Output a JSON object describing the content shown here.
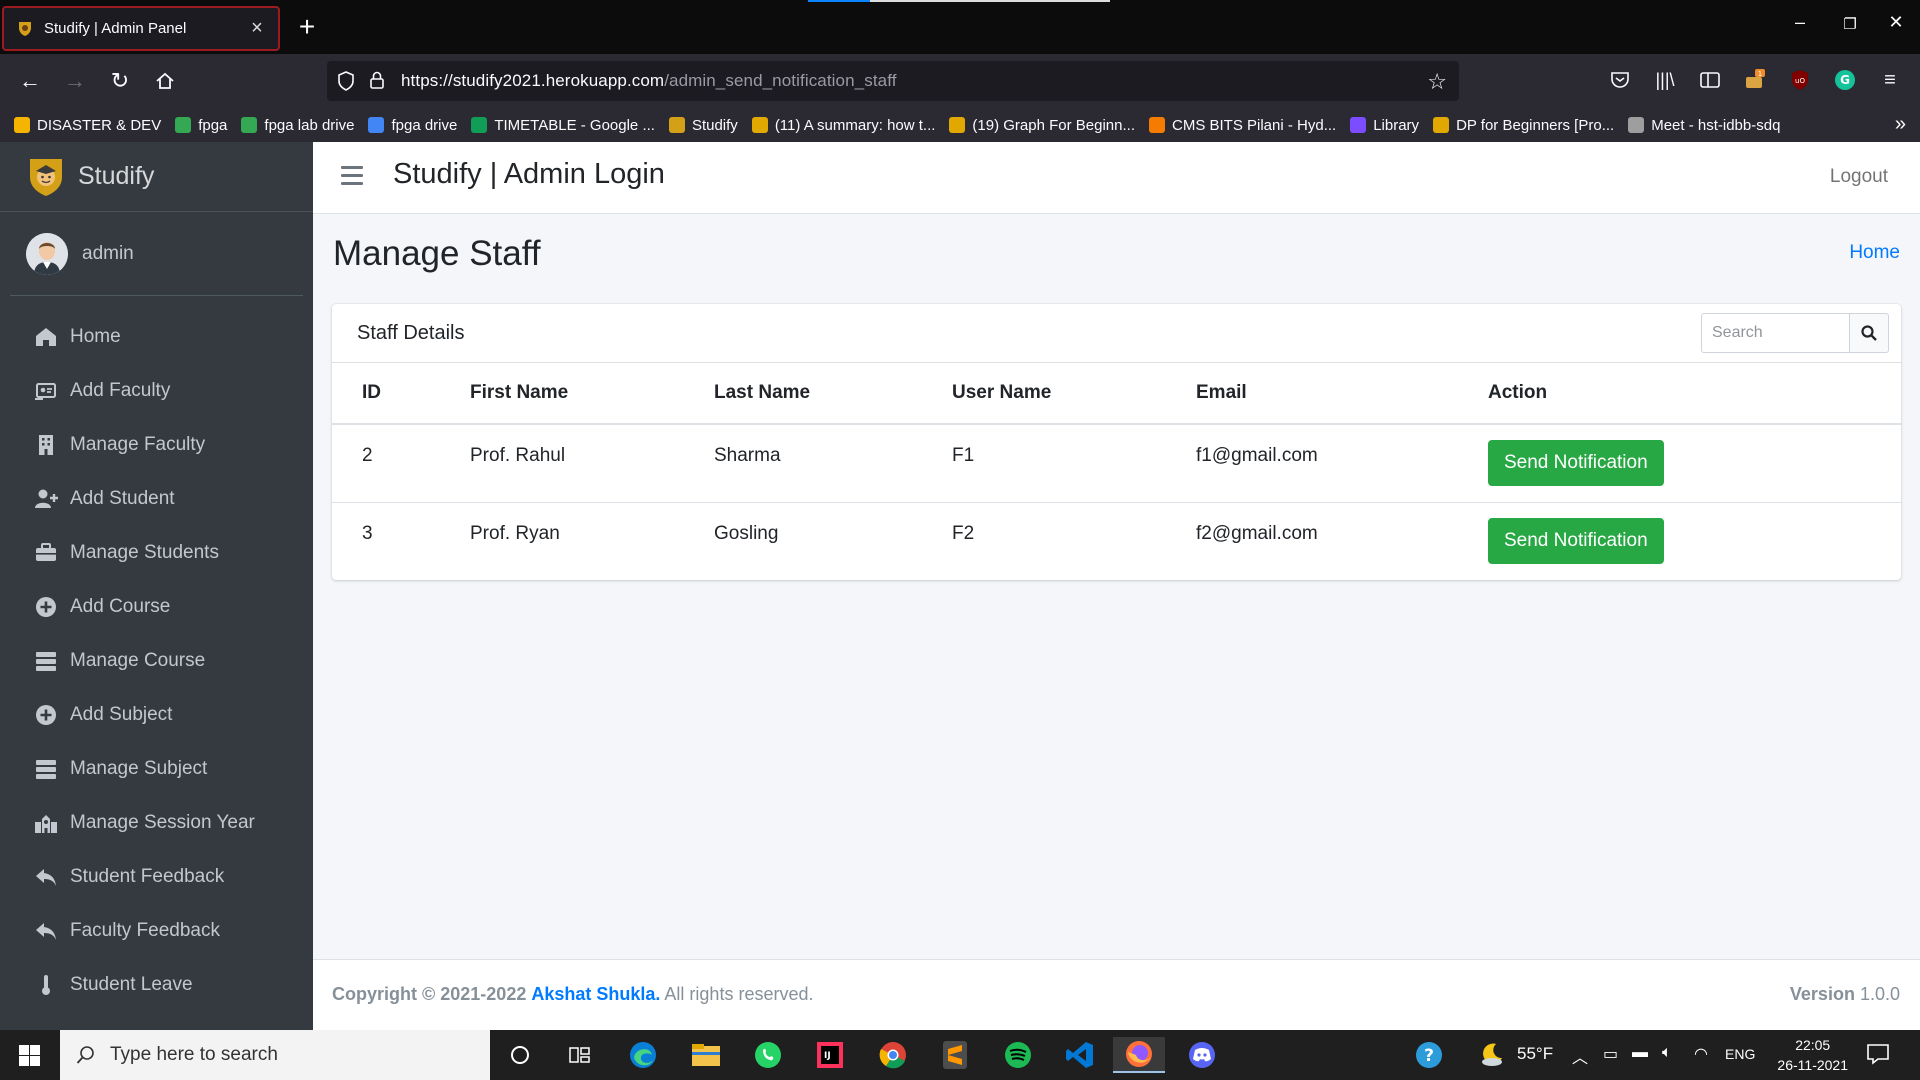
{
  "browser": {
    "tab_title": "Studify | Admin Panel",
    "new_tab": "+",
    "url_host": "https://studify2021.herokuapp.com",
    "url_path": "/admin_send_notification_staff",
    "bookmarks": [
      {
        "label": "DISASTER & DEV",
        "color": "#f4b400"
      },
      {
        "label": "fpga",
        "color": "#34a853"
      },
      {
        "label": "fpga lab drive",
        "color": "#34a853"
      },
      {
        "label": "fpga drive",
        "color": "#4285f4"
      },
      {
        "label": "TIMETABLE - Google ...",
        "color": "#0f9d58"
      },
      {
        "label": "Studify",
        "color": "#d4a017"
      },
      {
        "label": "(11) A summary: how t...",
        "color": "#e0a800"
      },
      {
        "label": "(19) Graph For Beginn...",
        "color": "#e0a800"
      },
      {
        "label": "CMS BITS Pilani - Hyd...",
        "color": "#f57c00"
      },
      {
        "label": "Library",
        "color": "#7c4dff"
      },
      {
        "label": "DP for Beginners [Pro...",
        "color": "#e0a800"
      },
      {
        "label": "Meet - hst-idbb-sdq",
        "color": "#9e9e9e"
      }
    ]
  },
  "sidebar": {
    "brand": "Studify",
    "user": "admin",
    "items": [
      {
        "label": "Home",
        "icon": "home-icon"
      },
      {
        "label": "Add Faculty",
        "icon": "id-card-icon"
      },
      {
        "label": "Manage Faculty",
        "icon": "building-icon"
      },
      {
        "label": "Add Student",
        "icon": "user-plus-icon"
      },
      {
        "label": "Manage Students",
        "icon": "briefcase-icon"
      },
      {
        "label": "Add Course",
        "icon": "plus-circle-icon"
      },
      {
        "label": "Manage Course",
        "icon": "server-icon"
      },
      {
        "label": "Add Subject",
        "icon": "plus-circle-icon"
      },
      {
        "label": "Manage Subject",
        "icon": "server-icon"
      },
      {
        "label": "Manage Session Year",
        "icon": "school-icon"
      },
      {
        "label": "Student Feedback",
        "icon": "reply-icon"
      },
      {
        "label": "Faculty Feedback",
        "icon": "reply-icon"
      },
      {
        "label": "Student Leave",
        "icon": "thermometer-icon"
      }
    ]
  },
  "topnav": {
    "title": "Studify | Admin Login",
    "logout": "Logout"
  },
  "page": {
    "title": "Manage Staff",
    "breadcrumb": "Home"
  },
  "card": {
    "title": "Staff Details",
    "search_placeholder": "Search",
    "columns": [
      "ID",
      "First Name",
      "Last Name",
      "User Name",
      "Email",
      "Action"
    ],
    "rows": [
      {
        "id": "2",
        "first": "Prof. Rahul",
        "last": "Sharma",
        "user": "F1",
        "email": "f1@gmail.com",
        "action": "Send Notification"
      },
      {
        "id": "3",
        "first": "Prof. Ryan",
        "last": "Gosling",
        "user": "F2",
        "email": "f2@gmail.com",
        "action": "Send Notification"
      }
    ]
  },
  "footer": {
    "copyright_prefix": "Copyright © 2021-2022",
    "author": "Akshat Shukla.",
    "suffix": "All rights reserved.",
    "version_label": "Version",
    "version": "1.0.0"
  },
  "taskbar": {
    "search_placeholder": "Type here to search",
    "weather": "55°F",
    "lang": "ENG",
    "time": "22:05",
    "date": "26-11-2021"
  },
  "colors": {
    "accent": "#007bff",
    "success": "#28a745",
    "sidebar_bg": "#343a40"
  }
}
